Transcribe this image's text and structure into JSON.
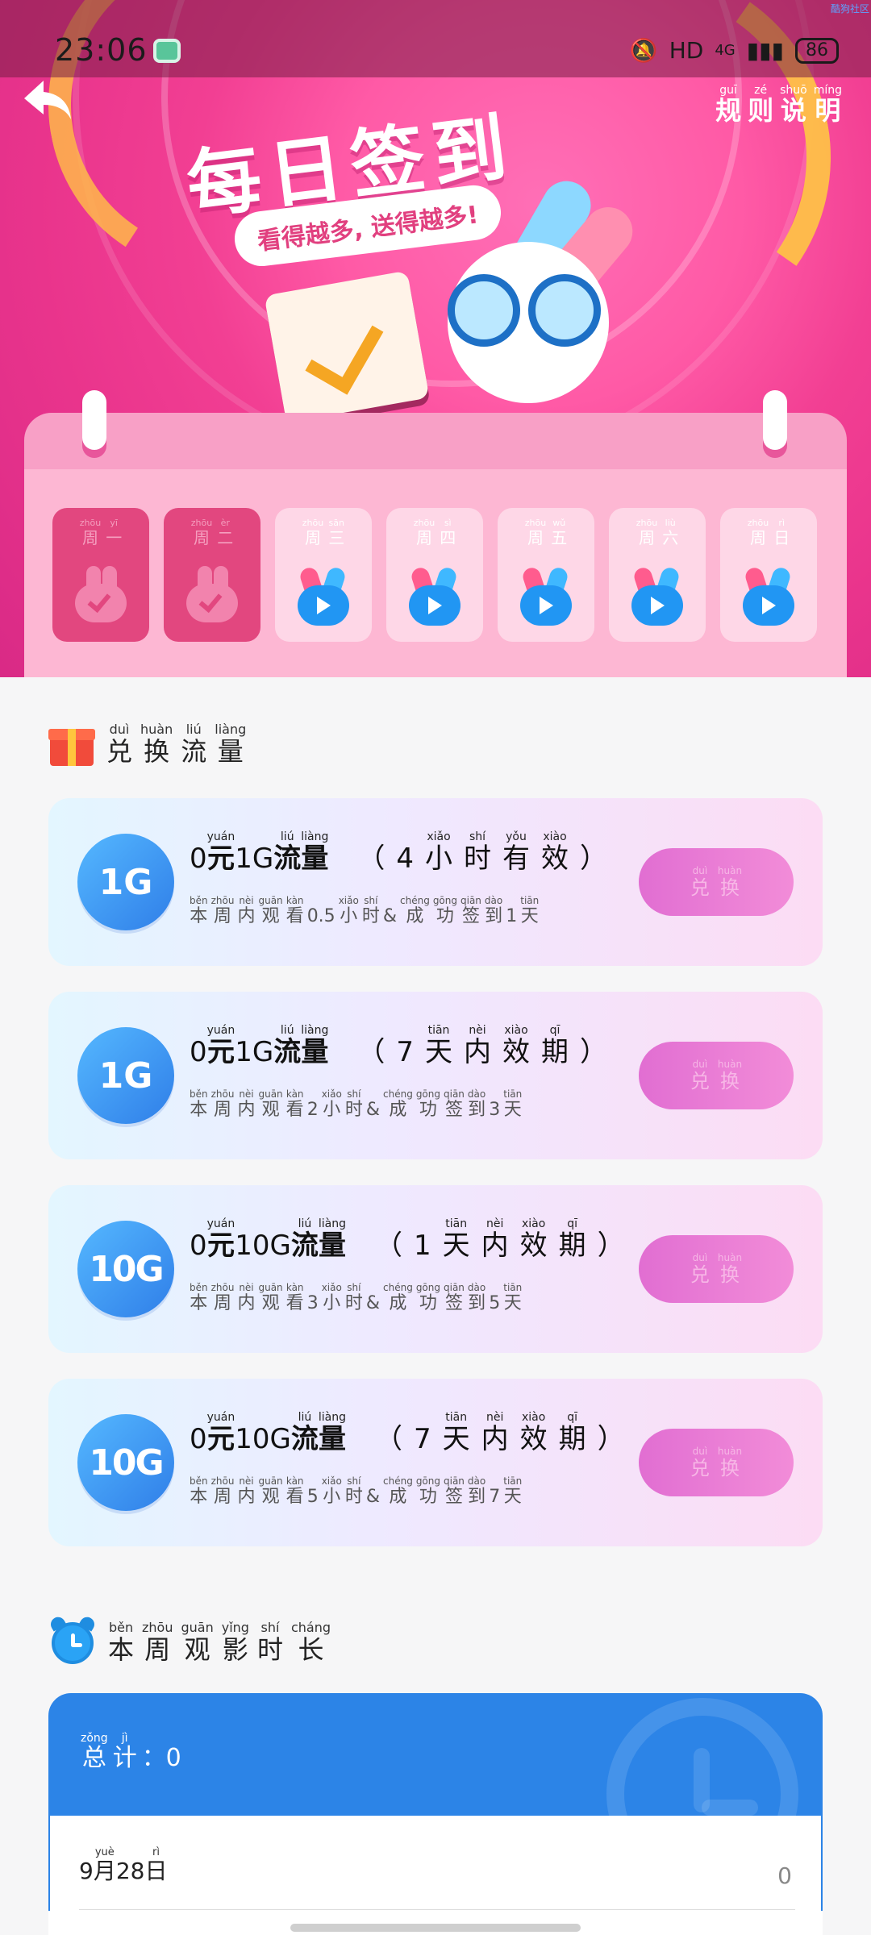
{
  "status_bar": {
    "time": "23:06",
    "network": "HD",
    "signal": "4G",
    "battery": "86"
  },
  "watermark": "酷狗社区",
  "header": {
    "rules": [
      {
        "py": "guī",
        "ch": "规"
      },
      {
        "py": "zé",
        "ch": "则"
      },
      {
        "py": "shuō",
        "ch": "说"
      },
      {
        "py": "míng",
        "ch": "明"
      }
    ],
    "title": "每日签到",
    "subtitle": "看得越多, 送得越多!"
  },
  "days": [
    {
      "state": "done",
      "w": [
        {
          "py": "zhōu",
          "ch": "周"
        },
        {
          "py": "yī",
          "ch": "一"
        }
      ]
    },
    {
      "state": "done",
      "w": [
        {
          "py": "zhōu",
          "ch": "周"
        },
        {
          "py": "èr",
          "ch": "二"
        }
      ]
    },
    {
      "state": "todo",
      "w": [
        {
          "py": "zhōu",
          "ch": "周"
        },
        {
          "py": "sān",
          "ch": "三"
        }
      ]
    },
    {
      "state": "todo",
      "w": [
        {
          "py": "zhōu",
          "ch": "周"
        },
        {
          "py": "sì",
          "ch": "四"
        }
      ]
    },
    {
      "state": "todo",
      "w": [
        {
          "py": "zhōu",
          "ch": "周"
        },
        {
          "py": "wǔ",
          "ch": "五"
        }
      ]
    },
    {
      "state": "todo",
      "w": [
        {
          "py": "zhōu",
          "ch": "周"
        },
        {
          "py": "liù",
          "ch": "六"
        }
      ]
    },
    {
      "state": "todo",
      "w": [
        {
          "py": "zhōu",
          "ch": "周"
        },
        {
          "py": "rì",
          "ch": "日"
        }
      ]
    }
  ],
  "exchange_section": {
    "title": [
      {
        "py": "duì",
        "ch": "兑"
      },
      {
        "py": "huàn",
        "ch": "换"
      },
      {
        "py": "liú",
        "ch": "流"
      },
      {
        "py": "liàng",
        "ch": "量"
      }
    ],
    "button": [
      {
        "py": "duì",
        "ch": "兑"
      },
      {
        "py": "huàn",
        "ch": "换"
      }
    ],
    "offers": [
      {
        "badge": "1G",
        "line1": [
          {
            "py": "",
            "ch": "0"
          },
          {
            "py": "yuán",
            "ch": "元",
            "b": 1
          },
          {
            "py": "",
            "ch": "1G"
          },
          {
            "py": "liú",
            "ch": "流",
            "b": 1
          },
          {
            "py": "liàng",
            "ch": "量",
            "b": 1
          },
          {
            "py": "",
            "ch": "（",
            "g": 1
          },
          {
            "py": "",
            "ch": "4",
            "g": 1
          },
          {
            "py": "xiǎo",
            "ch": "小",
            "g": 1
          },
          {
            "py": "shí",
            "ch": "时",
            "g": 1
          },
          {
            "py": "yǒu",
            "ch": "有",
            "g": 1
          },
          {
            "py": "xiào",
            "ch": "效",
            "g": 1
          },
          {
            "py": "",
            "ch": "）",
            "g": 1
          }
        ],
        "line2": [
          {
            "py": "běn",
            "ch": "本"
          },
          {
            "py": "zhōu",
            "ch": "周"
          },
          {
            "py": "nèi",
            "ch": "内"
          },
          {
            "py": "guān",
            "ch": "观"
          },
          {
            "py": "kàn",
            "ch": "看"
          },
          {
            "py": "",
            "ch": "0.5"
          },
          {
            "py": "xiǎo",
            "ch": "小"
          },
          {
            "py": "shí",
            "ch": "时"
          },
          {
            "py": "",
            "ch": "&"
          },
          {
            "py": "chéng",
            "ch": "成"
          },
          {
            "py": "gōng",
            "ch": "功"
          },
          {
            "py": "qiān",
            "ch": "签"
          },
          {
            "py": "dào",
            "ch": "到"
          },
          {
            "py": "",
            "ch": "1"
          },
          {
            "py": "tiān",
            "ch": "天"
          }
        ]
      },
      {
        "badge": "1G",
        "line1": [
          {
            "py": "",
            "ch": "0"
          },
          {
            "py": "yuán",
            "ch": "元",
            "b": 1
          },
          {
            "py": "",
            "ch": "1G"
          },
          {
            "py": "liú",
            "ch": "流",
            "b": 1
          },
          {
            "py": "liàng",
            "ch": "量",
            "b": 1
          },
          {
            "py": "",
            "ch": "（",
            "g": 1
          },
          {
            "py": "",
            "ch": "7",
            "g": 1
          },
          {
            "py": "tiān",
            "ch": "天",
            "g": 1
          },
          {
            "py": "nèi",
            "ch": "内",
            "g": 1
          },
          {
            "py": "xiào",
            "ch": "效",
            "g": 1
          },
          {
            "py": "qī",
            "ch": "期",
            "g": 1
          },
          {
            "py": "",
            "ch": "）",
            "g": 1
          }
        ],
        "line2": [
          {
            "py": "běn",
            "ch": "本"
          },
          {
            "py": "zhōu",
            "ch": "周"
          },
          {
            "py": "nèi",
            "ch": "内"
          },
          {
            "py": "guān",
            "ch": "观"
          },
          {
            "py": "kàn",
            "ch": "看"
          },
          {
            "py": "",
            "ch": "2"
          },
          {
            "py": "xiǎo",
            "ch": "小"
          },
          {
            "py": "shí",
            "ch": "时"
          },
          {
            "py": "",
            "ch": "&"
          },
          {
            "py": "chéng",
            "ch": "成"
          },
          {
            "py": "gōng",
            "ch": "功"
          },
          {
            "py": "qiān",
            "ch": "签"
          },
          {
            "py": "dào",
            "ch": "到"
          },
          {
            "py": "",
            "ch": "3"
          },
          {
            "py": "tiān",
            "ch": "天"
          }
        ]
      },
      {
        "badge": "10G",
        "line1": [
          {
            "py": "",
            "ch": "0"
          },
          {
            "py": "yuán",
            "ch": "元",
            "b": 1
          },
          {
            "py": "",
            "ch": "10G"
          },
          {
            "py": "liú",
            "ch": "流",
            "b": 1
          },
          {
            "py": "liàng",
            "ch": "量",
            "b": 1
          },
          {
            "py": "",
            "ch": "（",
            "g": 1
          },
          {
            "py": "",
            "ch": "1",
            "g": 1
          },
          {
            "py": "tiān",
            "ch": "天",
            "g": 1
          },
          {
            "py": "nèi",
            "ch": "内",
            "g": 1
          },
          {
            "py": "xiào",
            "ch": "效",
            "g": 1
          },
          {
            "py": "qī",
            "ch": "期",
            "g": 1
          },
          {
            "py": "",
            "ch": "）",
            "g": 1
          }
        ],
        "line2": [
          {
            "py": "běn",
            "ch": "本"
          },
          {
            "py": "zhōu",
            "ch": "周"
          },
          {
            "py": "nèi",
            "ch": "内"
          },
          {
            "py": "guān",
            "ch": "观"
          },
          {
            "py": "kàn",
            "ch": "看"
          },
          {
            "py": "",
            "ch": "3"
          },
          {
            "py": "xiǎo",
            "ch": "小"
          },
          {
            "py": "shí",
            "ch": "时"
          },
          {
            "py": "",
            "ch": "&"
          },
          {
            "py": "chéng",
            "ch": "成"
          },
          {
            "py": "gōng",
            "ch": "功"
          },
          {
            "py": "qiān",
            "ch": "签"
          },
          {
            "py": "dào",
            "ch": "到"
          },
          {
            "py": "",
            "ch": "5"
          },
          {
            "py": "tiān",
            "ch": "天"
          }
        ]
      },
      {
        "badge": "10G",
        "line1": [
          {
            "py": "",
            "ch": "0"
          },
          {
            "py": "yuán",
            "ch": "元",
            "b": 1
          },
          {
            "py": "",
            "ch": "10G"
          },
          {
            "py": "liú",
            "ch": "流",
            "b": 1
          },
          {
            "py": "liàng",
            "ch": "量",
            "b": 1
          },
          {
            "py": "",
            "ch": "（",
            "g": 1
          },
          {
            "py": "",
            "ch": "7",
            "g": 1
          },
          {
            "py": "tiān",
            "ch": "天",
            "g": 1
          },
          {
            "py": "nèi",
            "ch": "内",
            "g": 1
          },
          {
            "py": "xiào",
            "ch": "效",
            "g": 1
          },
          {
            "py": "qī",
            "ch": "期",
            "g": 1
          },
          {
            "py": "",
            "ch": "）",
            "g": 1
          }
        ],
        "line2": [
          {
            "py": "běn",
            "ch": "本"
          },
          {
            "py": "zhōu",
            "ch": "周"
          },
          {
            "py": "nèi",
            "ch": "内"
          },
          {
            "py": "guān",
            "ch": "观"
          },
          {
            "py": "kàn",
            "ch": "看"
          },
          {
            "py": "",
            "ch": "5"
          },
          {
            "py": "xiǎo",
            "ch": "小"
          },
          {
            "py": "shí",
            "ch": "时"
          },
          {
            "py": "",
            "ch": "&"
          },
          {
            "py": "chéng",
            "ch": "成"
          },
          {
            "py": "gōng",
            "ch": "功"
          },
          {
            "py": "qiān",
            "ch": "签"
          },
          {
            "py": "dào",
            "ch": "到"
          },
          {
            "py": "",
            "ch": "7"
          },
          {
            "py": "tiān",
            "ch": "天"
          }
        ]
      }
    ]
  },
  "watch_section": {
    "title": [
      {
        "py": "běn",
        "ch": "本"
      },
      {
        "py": "zhōu",
        "ch": "周"
      },
      {
        "py": "guān",
        "ch": "观"
      },
      {
        "py": "yǐng",
        "ch": "影"
      },
      {
        "py": "shí",
        "ch": "时"
      },
      {
        "py": "cháng",
        "ch": "长"
      }
    ],
    "total_words": [
      {
        "py": "zǒng",
        "ch": "总"
      },
      {
        "py": "jì",
        "ch": "计"
      }
    ],
    "total_value": "：0",
    "row": {
      "month": "9",
      "month_w": {
        "py": "yuè",
        "ch": "月"
      },
      "day": "28",
      "day_w": {
        "py": "rì",
        "ch": "日"
      },
      "value": "0"
    }
  }
}
